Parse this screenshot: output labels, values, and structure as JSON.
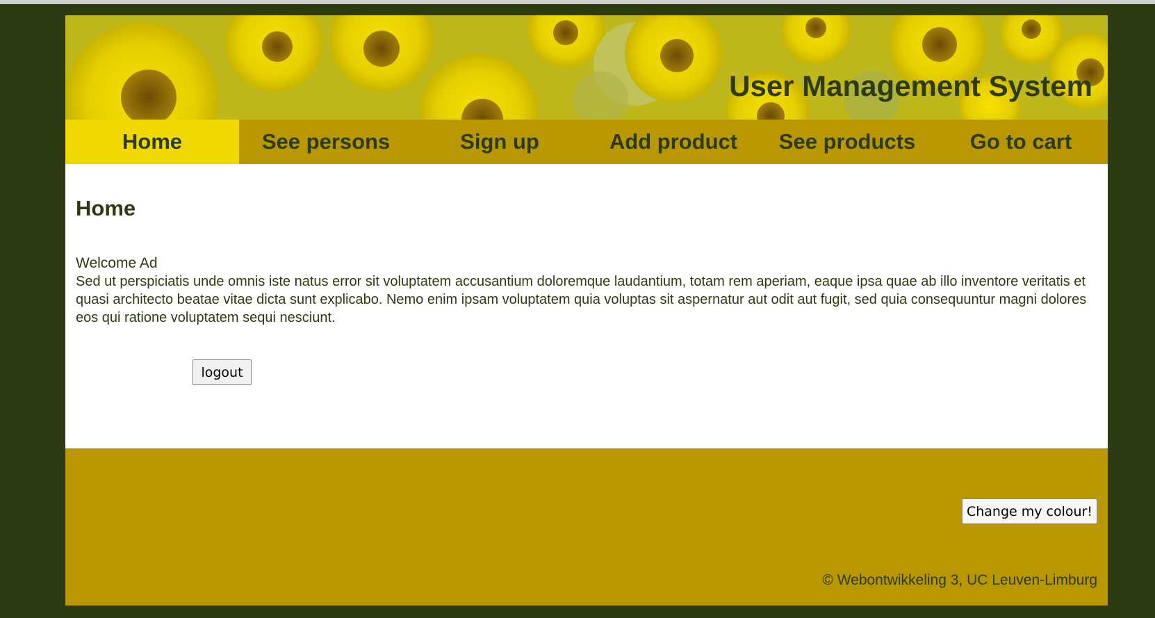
{
  "header": {
    "title": "User Management System"
  },
  "nav": {
    "items": [
      {
        "label": "Home"
      },
      {
        "label": "See persons"
      },
      {
        "label": "Sign up"
      },
      {
        "label": "Add product"
      },
      {
        "label": "See products"
      },
      {
        "label": "Go to cart"
      }
    ],
    "active": "Home"
  },
  "main": {
    "heading": "Home",
    "welcome": "Welcome Ad",
    "body": "Sed ut perspiciatis unde omnis iste natus error sit voluptatem accusantium doloremque laudantium, totam rem aperiam, eaque ipsa quae ab illo inventore veritatis et quasi architecto beatae vitae dicta sunt explicabo. Nemo enim ipsam voluptatem quia voluptas sit aspernatur aut odit aut fugit, sed quia consequuntur magni dolores eos qui ratione voluptatem sequi nesciunt.",
    "logout_label": "logout"
  },
  "footer": {
    "colour_button_label": "Change my colour!",
    "copyright": "© Webontwikkeling 3, UC Leuven-Limburg"
  },
  "colors": {
    "page_background": "#2e3b12",
    "nav_background": "#b89700",
    "nav_active": "#f0d900",
    "text": "#2e3b12",
    "footer_background": "#b89700"
  }
}
